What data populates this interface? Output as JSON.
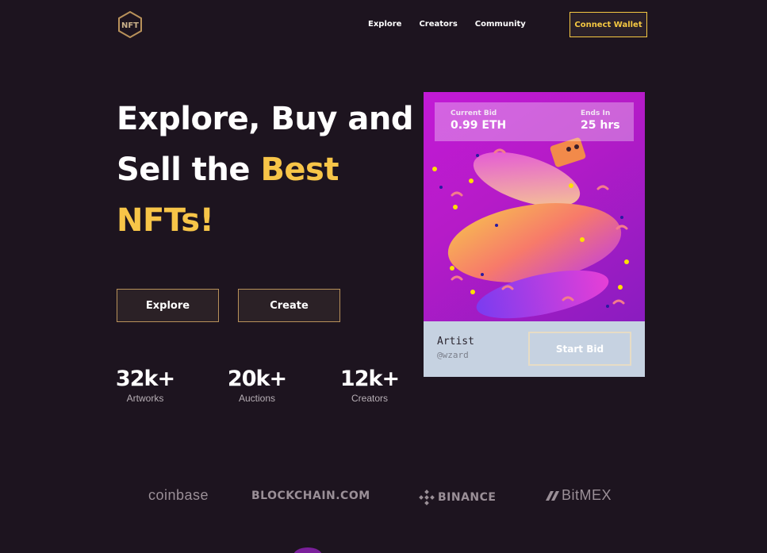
{
  "nav": {
    "logo_text": "NFT",
    "links": [
      "Explore",
      "Creators",
      "Community"
    ],
    "connect_label": "Connect Wallet"
  },
  "hero": {
    "title_line1": "Explore, Buy and",
    "title_line2": "Sell the ",
    "title_accent2": "Best",
    "title_accent3": "NFTs!",
    "explore_label": "Explore",
    "create_label": "Create"
  },
  "stats": [
    {
      "value": "32k+",
      "label": "Artworks"
    },
    {
      "value": "20k+",
      "label": "Auctions"
    },
    {
      "value": "12k+",
      "label": "Creators"
    }
  ],
  "card": {
    "current_bid_label": "Current Bid",
    "current_bid_value": "0.99 ETH",
    "ends_label": "Ends In",
    "ends_value": "25 hrs",
    "artist_label": "Artist",
    "artist_handle": "@wzard",
    "start_bid_label": "Start Bid"
  },
  "brands": {
    "coinbase": "coinbase",
    "blockchain": "BLOCKCHAIN.COM",
    "binance": "BINANCE",
    "bitmex": "BitMEX"
  },
  "colors": {
    "background": "#1d141f",
    "accent": "#f7c548",
    "button_border": "#b8915a"
  }
}
